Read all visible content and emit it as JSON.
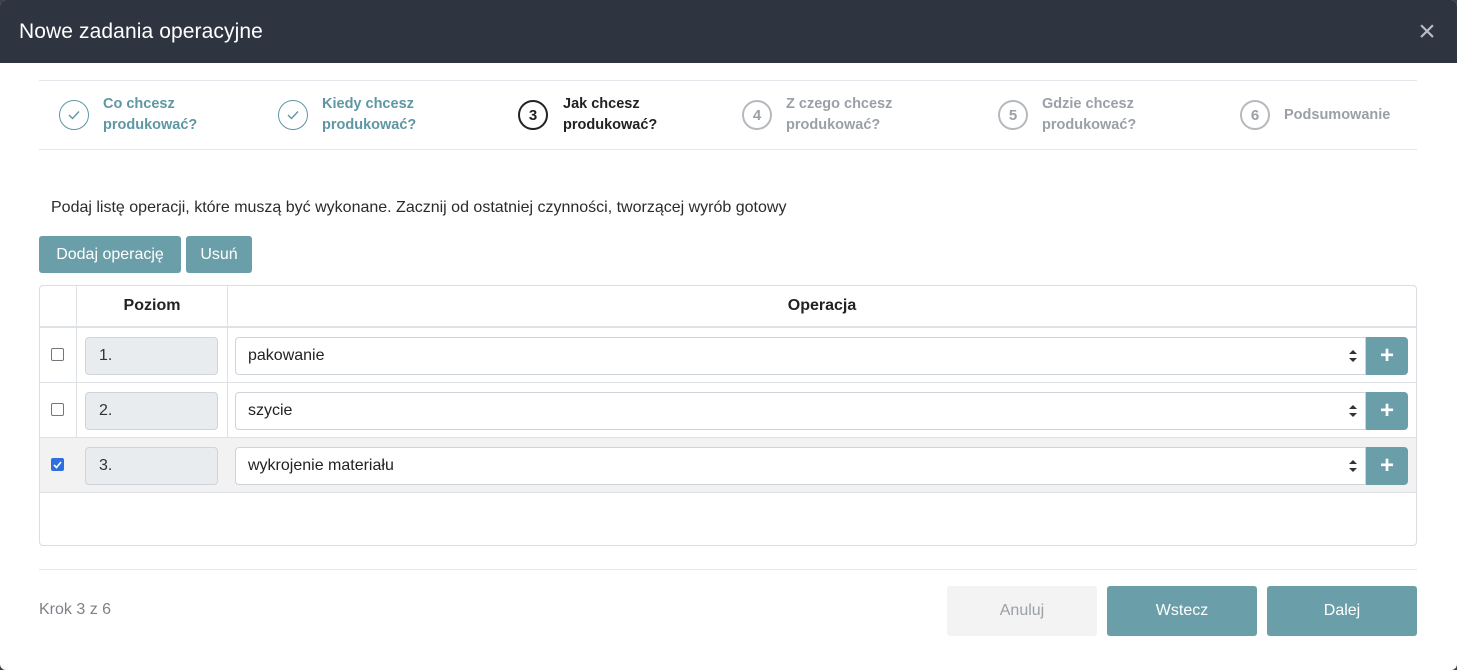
{
  "modal": {
    "title": "Nowe zadania operacyjne",
    "close_icon": "close-icon"
  },
  "steps": [
    {
      "marker": "✓",
      "label": "Co chcesz produkować?",
      "state": "done"
    },
    {
      "marker": "✓",
      "label": "Kiedy chcesz produkować?",
      "state": "done"
    },
    {
      "marker": "3",
      "label": "Jak chcesz produkować?",
      "state": "active"
    },
    {
      "marker": "4",
      "label": "Z czego chcesz produkować?",
      "state": "todo"
    },
    {
      "marker": "5",
      "label": "Gdzie chcesz produkować?",
      "state": "todo"
    },
    {
      "marker": "6",
      "label": "Podsumowanie",
      "state": "todo"
    }
  ],
  "instruction": "Podaj listę operacji, które muszą być wykonane. Zacznij od ostatniej czynności, tworzącej wyrób gotowy",
  "toolbar": {
    "add_label": "Dodaj operację",
    "delete_label": "Usuń"
  },
  "table": {
    "headers": {
      "level": "Poziom",
      "operation": "Operacja"
    },
    "rows": [
      {
        "checked": false,
        "level": "1.",
        "operation": "pakowanie",
        "add": "+"
      },
      {
        "checked": false,
        "level": "2.",
        "operation": "szycie",
        "add": "+"
      },
      {
        "checked": true,
        "level": "3.",
        "operation": "wykrojenie materiału",
        "add": "+"
      }
    ]
  },
  "footer": {
    "step_counter": "Krok 3 z 6",
    "cancel_label": "Anuluj",
    "back_label": "Wstecz",
    "next_label": "Dalej"
  },
  "colors": {
    "accent": "#6a9ea8",
    "header_bg": "#2f3540",
    "step_done": "#5e97a3",
    "checkbox_checked": "#2d6fe0"
  }
}
